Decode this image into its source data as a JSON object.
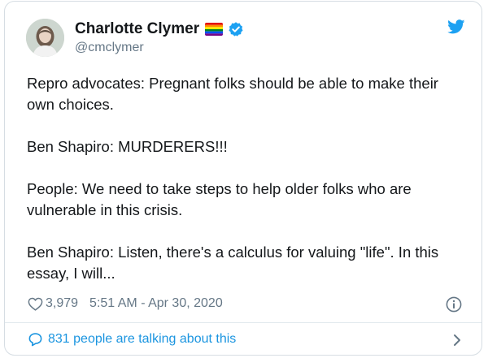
{
  "author": {
    "name": "Charlotte Clymer",
    "handle": "@cmclymer"
  },
  "tweet": {
    "paragraphs": [
      "Repro advocates: Pregnant folks should be able to make their own choices.",
      "Ben Shapiro: MURDERERS!!!",
      "People: We need to take steps to help older folks who are vulnerable in this crisis.",
      "Ben Shapiro: Listen, there's a calculus for valuing \"life\". In this essay, I will..."
    ],
    "likes": "3,979",
    "timestamp": "5:51 AM - Apr 30, 2020",
    "talking_label": "831 people are talking about this"
  },
  "colors": {
    "twitter_blue": "#1da1f2",
    "link_blue": "#1b95e0",
    "secondary_text": "#657786",
    "primary_text": "#14171a",
    "border": "#d6dde3"
  },
  "icons": {
    "avatar": "avatar",
    "flag": "rainbow-flag-icon",
    "verified": "verified-badge-icon",
    "logo": "twitter-bird-icon",
    "like": "heart-icon",
    "info": "info-icon",
    "reply": "speech-bubble-icon",
    "more": "chevron-right-icon"
  }
}
